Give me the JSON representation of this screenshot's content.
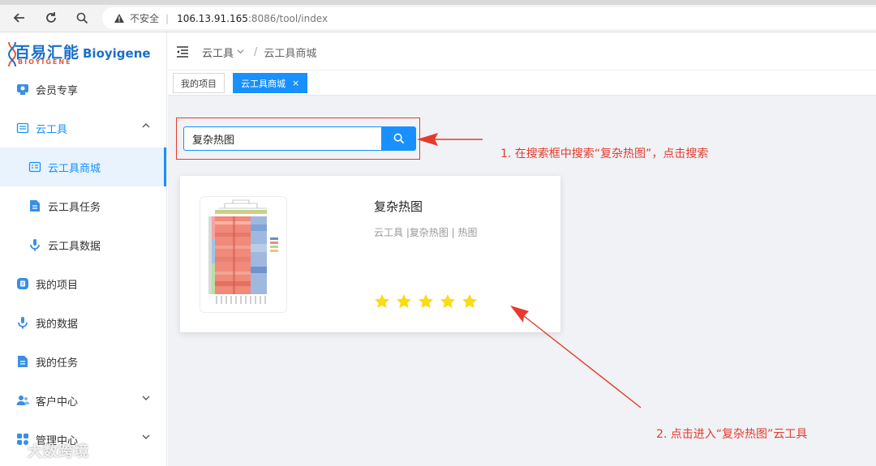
{
  "browser": {
    "insecure_label": "不安全",
    "url_host": "106.13.91.165",
    "url_path": ":8086/tool/index"
  },
  "brand": {
    "logo_cn": "百易汇能",
    "logo_en_small": "BIOYIGENE",
    "logo_en": "Bioyigene"
  },
  "sidebar": {
    "items": [
      {
        "label": "会员专享",
        "icon": "member-icon"
      },
      {
        "label": "云工具",
        "icon": "cloud-tool-icon"
      },
      {
        "label": "云工具商城",
        "icon": "mall-icon"
      },
      {
        "label": "云工具任务",
        "icon": "task-doc-icon"
      },
      {
        "label": "云工具数据",
        "icon": "data-icon"
      },
      {
        "label": "我的项目",
        "icon": "project-icon"
      },
      {
        "label": "我的数据",
        "icon": "data-icon"
      },
      {
        "label": "我的任务",
        "icon": "task-doc-icon"
      },
      {
        "label": "客户中心",
        "icon": "customer-icon"
      },
      {
        "label": "管理中心",
        "icon": "admin-icon"
      }
    ]
  },
  "header": {
    "crumb_root": "云工具",
    "crumb_sep": "/",
    "crumb_current": "云工具商城"
  },
  "tabs": [
    {
      "label": "我的项目"
    },
    {
      "label": "云工具商城",
      "close": "×"
    }
  ],
  "search": {
    "value": "复杂热图"
  },
  "card": {
    "title": "复杂热图",
    "tags": "云工具 |复杂热图 | 热图",
    "rating": 5,
    "max_rating": 5
  },
  "annotations": {
    "step1": "1. 在搜索框中搜索“复杂热图”，点击搜索",
    "step2": "2. 点击进入“复杂热图”云工具"
  },
  "watermark": "大数跨境",
  "colors": {
    "accent": "#1890ff",
    "annotation": "#e53a2c",
    "star": "#fadb14"
  }
}
